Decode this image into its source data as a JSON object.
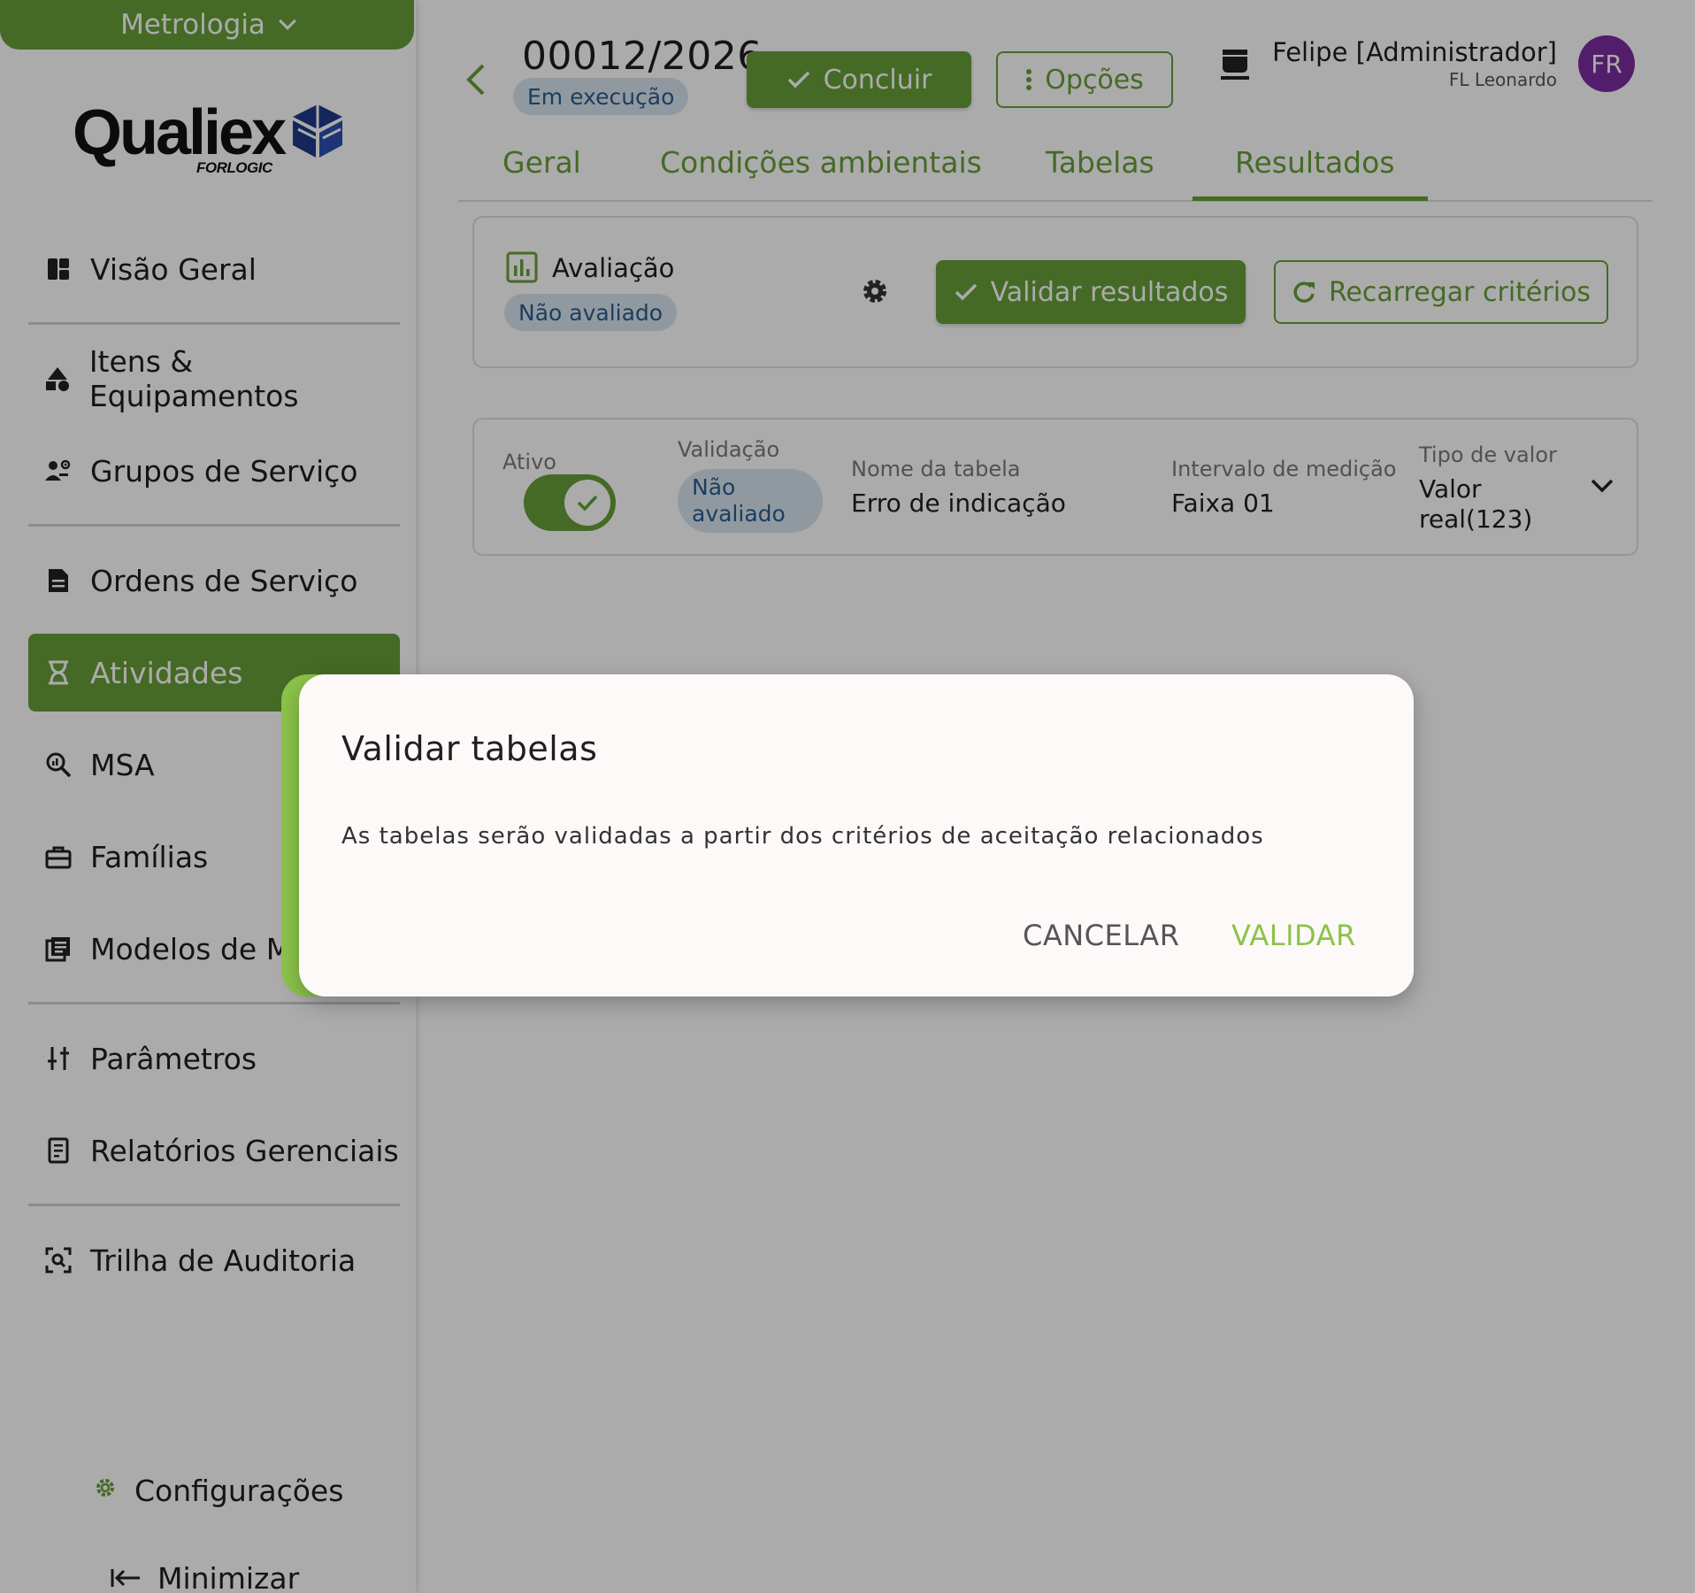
{
  "sidebar": {
    "module": "Metrologia",
    "logo": {
      "word": "Qualiex",
      "sub": "FORLOGIC"
    },
    "items": [
      {
        "label": "Visão Geral"
      },
      {
        "label": "Itens & Equipamentos"
      },
      {
        "label": "Grupos de Serviço"
      },
      {
        "label": "Ordens de Serviço"
      },
      {
        "label": "Atividades"
      },
      {
        "label": "MSA"
      },
      {
        "label": "Famílias"
      },
      {
        "label": "Modelos de Medição"
      },
      {
        "label": "Parâmetros"
      },
      {
        "label": "Relatórios Gerenciais"
      },
      {
        "label": "Trilha de Auditoria"
      }
    ],
    "config_label": "Configurações",
    "minimize_label": "Minimizar"
  },
  "header": {
    "os_number": "00012/2026",
    "status": "Em execução",
    "conclude_label": "Concluir",
    "options_label": "Opções",
    "user_name": "Felipe [Administrador]",
    "user_org": "FL Leonardo",
    "avatar_initials": "FR"
  },
  "tabs": [
    {
      "label": "Geral"
    },
    {
      "label": "Condições ambientais"
    },
    {
      "label": "Tabelas"
    },
    {
      "label": "Resultados"
    }
  ],
  "evaluation": {
    "title": "Avaliação",
    "status": "Não avaliado",
    "validate_label": "Validar resultados",
    "reload_label": "Recarregar critérios"
  },
  "table_row": {
    "active_label": "Ativo",
    "validation_label": "Validação",
    "validation_value_line1": "Não",
    "validation_value_line2": "avaliado",
    "name_label": "Nome da tabela",
    "name_value": "Erro de indicação",
    "interval_label": "Intervalo de medição",
    "interval_value": "Faixa 01",
    "type_label": "Tipo de valor",
    "type_value_line1": "Valor",
    "type_value_line2": "real(123)"
  },
  "dialog": {
    "title": "Validar tabelas",
    "body": "As tabelas serão validadas a partir dos critérios de aceitação relacionados",
    "cancel_label": "CANCELAR",
    "confirm_label": "VALIDAR"
  },
  "colors": {
    "brand_green": "#689f38",
    "accent_green": "#8bc34a",
    "pill_bg": "#d9e4ef",
    "pill_text": "#2b5d8c",
    "avatar": "#7b2ea0"
  }
}
